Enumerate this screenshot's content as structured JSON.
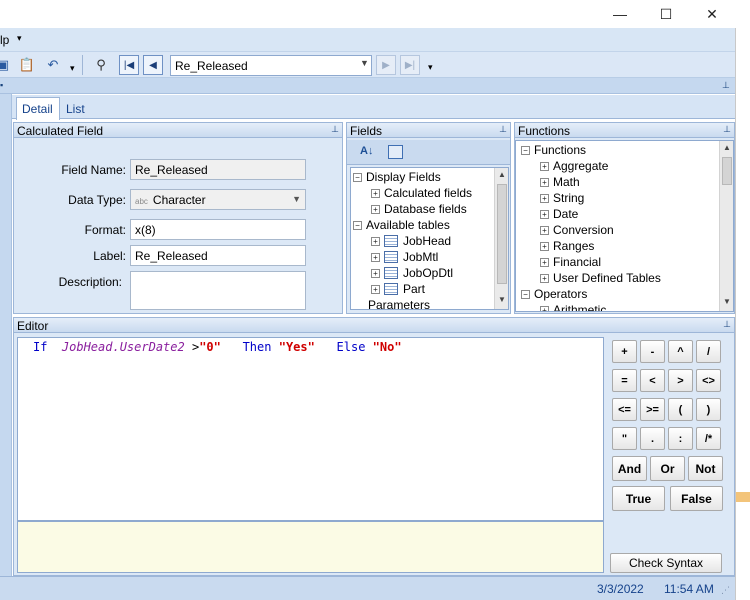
{
  "window": {
    "minimize_glyph": "—",
    "maximize_glyph": "☐",
    "close_glyph": "✕"
  },
  "menu": {
    "help_label": "lp"
  },
  "toolbar": {
    "record_value": "Re_Released",
    "icons": [
      "paste-icon",
      "undo-icon",
      "binoculars-icon",
      "first-record-icon",
      "previous-record-icon",
      "next-record-icon",
      "last-record-icon"
    ]
  },
  "tabs": [
    {
      "label": "Detail",
      "active": true
    },
    {
      "label": "List",
      "active": false
    }
  ],
  "calc_panel": {
    "title": "Calculated Field",
    "field_name_label": "Field Name:",
    "field_name_value": "Re_Released",
    "data_type_label": "Data Type:",
    "data_type_prefix": "abc",
    "data_type_value": "Character",
    "format_label": "Format:",
    "format_value": "x(8)",
    "label_label": "Label:",
    "label_value": "Re_Released",
    "description_label": "Description:",
    "description_value": ""
  },
  "fields_panel": {
    "title": "Fields",
    "tree": {
      "display_fields": "Display Fields",
      "calculated_fields": "Calculated fields",
      "database_fields": "Database fields",
      "available_tables": "Available tables",
      "tables": [
        "JobHead",
        "JobMtl",
        "JobOpDtl",
        "Part"
      ],
      "parameters": "Parameters"
    }
  },
  "functions_panel": {
    "title": "Functions",
    "tree": {
      "functions": "Functions",
      "items": [
        "Aggregate",
        "Math",
        "String",
        "Date",
        "Conversion",
        "Ranges",
        "Financial",
        "User Defined Tables"
      ],
      "operators": "Operators",
      "operator_items": [
        "Arithmetic"
      ]
    }
  },
  "editor": {
    "title": "Editor",
    "code": {
      "if_kw": "If",
      "field": "JobHead.UserDate2",
      "op": ">",
      "zero": "\"0\"",
      "then_kw": "Then",
      "yes": "\"Yes\"",
      "else_kw": "Else",
      "no": "\"No\""
    },
    "buttons": {
      "plus": "+",
      "minus": "-",
      "caret": "^",
      "slash": "/",
      "eq": "=",
      "lt": "<",
      "gt": ">",
      "ne": "<>",
      "le": "<=",
      "ge": ">=",
      "lparen": "(",
      "rparen": ")",
      "quote": "\"",
      "dot": ".",
      "colon": ":",
      "comment": "/*",
      "and": "And",
      "or": "Or",
      "not": "Not",
      "true": "True",
      "false": "False"
    },
    "check_syntax_label": "Check Syntax"
  },
  "status": {
    "date": "3/3/2022",
    "time": "11:54 AM"
  }
}
